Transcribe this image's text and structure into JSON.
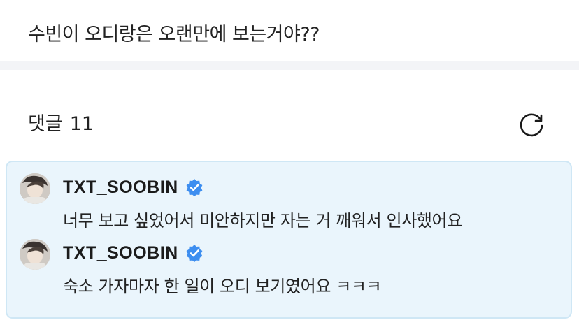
{
  "post": {
    "text": "수빈이 오디랑은 오랜만에 보는거야??"
  },
  "comments_section": {
    "title": "댓글",
    "count": "11",
    "refresh_icon": "refresh-icon"
  },
  "comments": [
    {
      "author": "TXT_SOOBIN",
      "verified_icon": "verified-badge-icon",
      "text": "너무 보고 싶었어서 미안하지만 자는 거 깨워서 인사했어요"
    },
    {
      "author": "TXT_SOOBIN",
      "verified_icon": "verified-badge-icon",
      "text": "숙소 가자마자 한 일이 오디 보기였어요 ㅋㅋㅋ"
    }
  ],
  "colors": {
    "highlight_bg": "#eaf5fc",
    "highlight_border": "#cfe7f5",
    "verified_blue": "#3d8ef0",
    "divider": "#f3f4f7"
  }
}
